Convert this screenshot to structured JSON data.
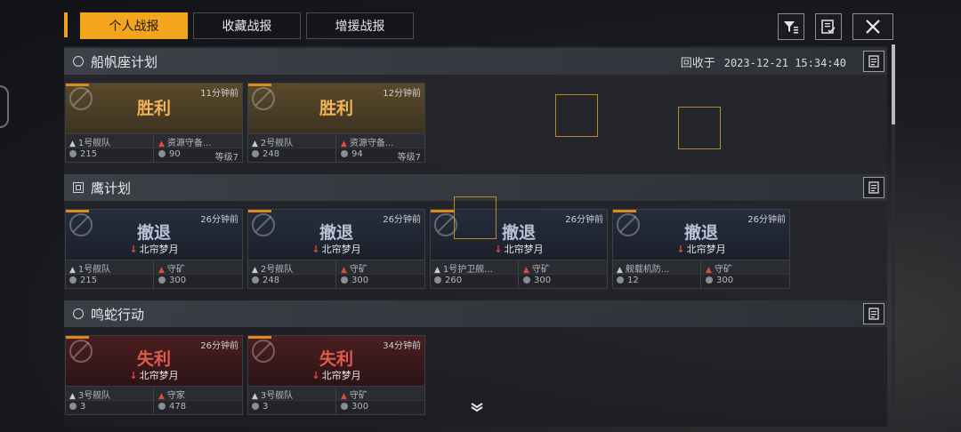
{
  "tabs": [
    {
      "label": "个人战报",
      "active": true
    },
    {
      "label": "收藏战报",
      "active": false
    },
    {
      "label": "增援战报",
      "active": false
    }
  ],
  "toolbar": {
    "filter_icon": "filter-icon",
    "checklist_icon": "checklist-icon",
    "close_icon": "close-icon"
  },
  "sections": [
    {
      "title": "船帆座计划",
      "icon": "circle",
      "recycle_label": "回收于",
      "recycle_time": "2023-12-21 15:34:40",
      "cards": [
        {
          "ago": "11分钟前",
          "result": "胜利",
          "type": "win",
          "opponent": "",
          "fleet": "1号舰队",
          "mission": "资源守备...",
          "power": "215",
          "target_power": "90",
          "level": "等级7"
        },
        {
          "ago": "12分钟前",
          "result": "胜利",
          "type": "win",
          "opponent": "",
          "fleet": "2号舰队",
          "mission": "资源守备...",
          "power": "248",
          "target_power": "94",
          "level": "等级7"
        }
      ]
    },
    {
      "title": "鹰计划",
      "icon": "square",
      "recycle_label": "",
      "recycle_time": "",
      "cards": [
        {
          "ago": "26分钟前",
          "result": "撤退",
          "type": "retreat",
          "opponent": "北帘梦月",
          "fleet": "1号舰队",
          "mission": "守矿",
          "power": "215",
          "target_power": "300",
          "level": ""
        },
        {
          "ago": "26分钟前",
          "result": "撤退",
          "type": "retreat",
          "opponent": "北帘梦月",
          "fleet": "2号舰队",
          "mission": "守矿",
          "power": "248",
          "target_power": "300",
          "level": ""
        },
        {
          "ago": "26分钟前",
          "result": "撤退",
          "type": "retreat",
          "opponent": "北帘梦月",
          "fleet": "1号护卫舰...",
          "mission": "守矿",
          "power": "260",
          "target_power": "300",
          "level": ""
        },
        {
          "ago": "26分钟前",
          "result": "撤退",
          "type": "retreat",
          "opponent": "北帘梦月",
          "fleet": "舰载机防...",
          "mission": "守矿",
          "power": "12",
          "target_power": "300",
          "level": ""
        }
      ]
    },
    {
      "title": "鸣蛇行动",
      "icon": "circle",
      "recycle_label": "",
      "recycle_time": "",
      "cards": [
        {
          "ago": "26分钟前",
          "result": "失利",
          "type": "loss",
          "opponent": "北帘梦月",
          "fleet": "3号舰队",
          "mission": "守家",
          "power": "3",
          "target_power": "478",
          "level": ""
        },
        {
          "ago": "34分钟前",
          "result": "失利",
          "type": "loss",
          "opponent": "北帘梦月",
          "fleet": "3号舰队",
          "mission": "守矿",
          "power": "3",
          "target_power": "300",
          "level": ""
        }
      ]
    }
  ],
  "colors": {
    "accent": "#f3a51b",
    "win": "#f0b35a",
    "loss": "#e05a4e",
    "retreat": "#b8c3d6"
  },
  "scroll_more_icon": "chevron-down-icon"
}
